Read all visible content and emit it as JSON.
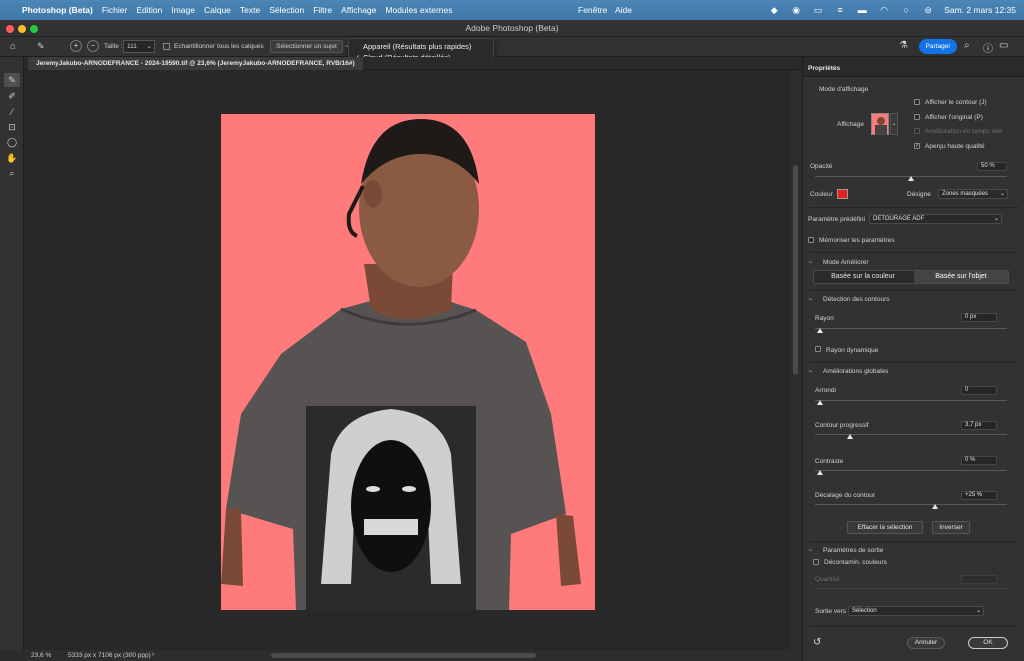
{
  "menubar": {
    "app_name": "Photoshop (Beta)",
    "menus": [
      "Fichier",
      "Edition",
      "Image",
      "Calque",
      "Texte",
      "Sélection",
      "Filtre",
      "Affichage",
      "Modules externes",
      "Fenêtre",
      "Aide"
    ],
    "clock": "Sam. 2 mars  12:35"
  },
  "window": {
    "title": "Adobe Photoshop (Beta)"
  },
  "options": {
    "size_label": "Taille :",
    "size_value": "111",
    "sample_all_label": "Echantillonner tous les calques",
    "select_subject_label": "Sélectionner un sujet",
    "share_label": "Partager"
  },
  "dropdown": {
    "items": [
      {
        "label": "Appareil (Résultats plus rapides)",
        "checked": false
      },
      {
        "label": "Cloud (Résultats détaillés)",
        "checked": true
      }
    ]
  },
  "document": {
    "tab_title": "JeremyJakubo-ARNODEFRANCE - 2024-19590.tif @ 23,6% (JeremyJakubo-ARNODEFRANCE, RVB/16#)",
    "zoom": "23,6 %",
    "dimensions": "5333 px x 7106 px (300 ppp)"
  },
  "panel": {
    "title": "Propriétés",
    "view_mode_title": "Mode d'affichage",
    "display_label": "Affichage",
    "show_edge_label": "Afficher le contour (J)",
    "show_original_label": "Afficher l'original (P)",
    "realtime_label": "Amélioration en temps réel",
    "high_quality_label": "Aperçu haute qualité",
    "opacity_label": "Opacité",
    "opacity_value": "50 %",
    "opacity_fraction": 0.5,
    "color_label": "Couleur",
    "color_hex": "#e8201f",
    "indicates_label": "Désigne",
    "indicates_value": "Zones masquées",
    "preset_label": "Paramètre prédéfini",
    "preset_value": "DETOURAGE ADF",
    "remember_label": "Mémoriser les paramètres",
    "refine_mode_title": "Mode Améliorer",
    "refine_color_label": "Basée sur la couleur",
    "refine_object_label": "Basée sur l'objet",
    "edge_detection_title": "Détection des contours",
    "radius_label": "Rayon",
    "radius_value": "0 px",
    "smart_radius_label": "Rayon dynamique",
    "global_title": "Améliorations globales",
    "smooth_label": "Arrondi",
    "smooth_value": "0",
    "feather_label": "Contour progressif",
    "feather_value": "3,7 px",
    "feather_fraction": 0.18,
    "contrast_label": "Contraste",
    "contrast_value": "0 %",
    "shift_label": "Décalage du contour",
    "shift_value": "+25 %",
    "shift_fraction": 0.625,
    "clear_selection_label": "Effacer la sélection",
    "invert_label": "Inverser",
    "output_title": "Paramètres de sortie",
    "decontaminate_label": "Décontamin. couleurs",
    "amount_label": "Quantité",
    "output_to_label": "Sortie vers",
    "output_to_value": "Sélection",
    "cancel_label": "Annuler",
    "ok_label": "OK"
  }
}
